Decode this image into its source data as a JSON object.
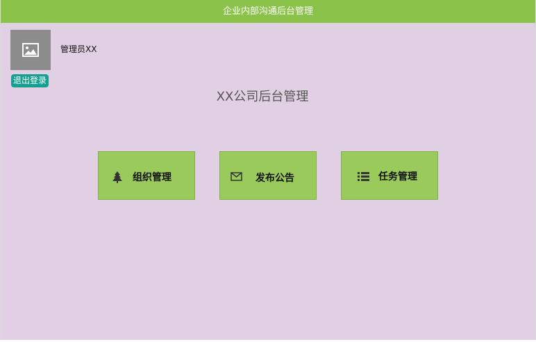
{
  "header": {
    "title": "企业内部沟通后台管理",
    "bg_color": "#8bc34a"
  },
  "user": {
    "avatar_icon": "image-placeholder-icon",
    "name": "管理员XX",
    "logout_label": "退出登录"
  },
  "main": {
    "title": "XX公司后台管理"
  },
  "tiles": [
    {
      "label": "组织管理",
      "icon": "tree-icon"
    },
    {
      "label": "发布公告",
      "icon": "envelope-icon"
    },
    {
      "label": "任务管理",
      "icon": "list-icon"
    }
  ],
  "colors": {
    "page_bg": "#e1d0e3",
    "tile_bg": "#99ca5b",
    "logout_bg": "#159f90"
  }
}
